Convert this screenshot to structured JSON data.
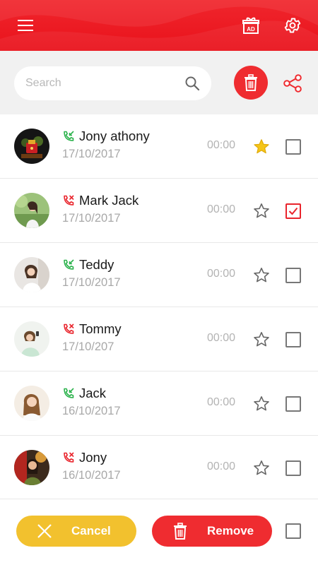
{
  "header": {
    "menu_icon": "hamburger-menu-icon",
    "ad_icon": "gift-ad-icon",
    "ad_badge": "AD",
    "settings_icon": "gear-icon"
  },
  "search": {
    "placeholder": "Search",
    "value": "",
    "icon": "search-icon"
  },
  "actions": {
    "delete_icon": "trash-icon",
    "share_icon": "share-icon"
  },
  "colors": {
    "brand_red": "#ef2c30",
    "cancel_yellow": "#f2c12e",
    "incoming_green": "#2bb24c",
    "missed_red": "#e9242c",
    "star_gold": "#f5c518"
  },
  "calls": [
    {
      "name": "Jony athony",
      "date": "17/10/2017",
      "duration": "00:00",
      "call_type": "incoming",
      "starred": true,
      "selected": false
    },
    {
      "name": "Mark Jack",
      "date": "17/10/2017",
      "duration": "00:00",
      "call_type": "missed",
      "starred": false,
      "selected": true
    },
    {
      "name": "Teddy",
      "date": "17/10/2017",
      "duration": "00:00",
      "call_type": "incoming",
      "starred": false,
      "selected": false
    },
    {
      "name": "Tommy",
      "date": "17/10/207",
      "duration": "00:00",
      "call_type": "missed",
      "starred": false,
      "selected": false
    },
    {
      "name": "Jack",
      "date": "16/10/2017",
      "duration": "00:00",
      "call_type": "incoming",
      "starred": false,
      "selected": false
    },
    {
      "name": "Jony",
      "date": "16/10/2017",
      "duration": "00:00",
      "call_type": "missed",
      "starred": false,
      "selected": false
    }
  ],
  "footer": {
    "cancel_label": "Cancel",
    "remove_label": "Remove",
    "cancel_icon": "close-icon",
    "remove_icon": "trash-icon",
    "select_all": false
  }
}
